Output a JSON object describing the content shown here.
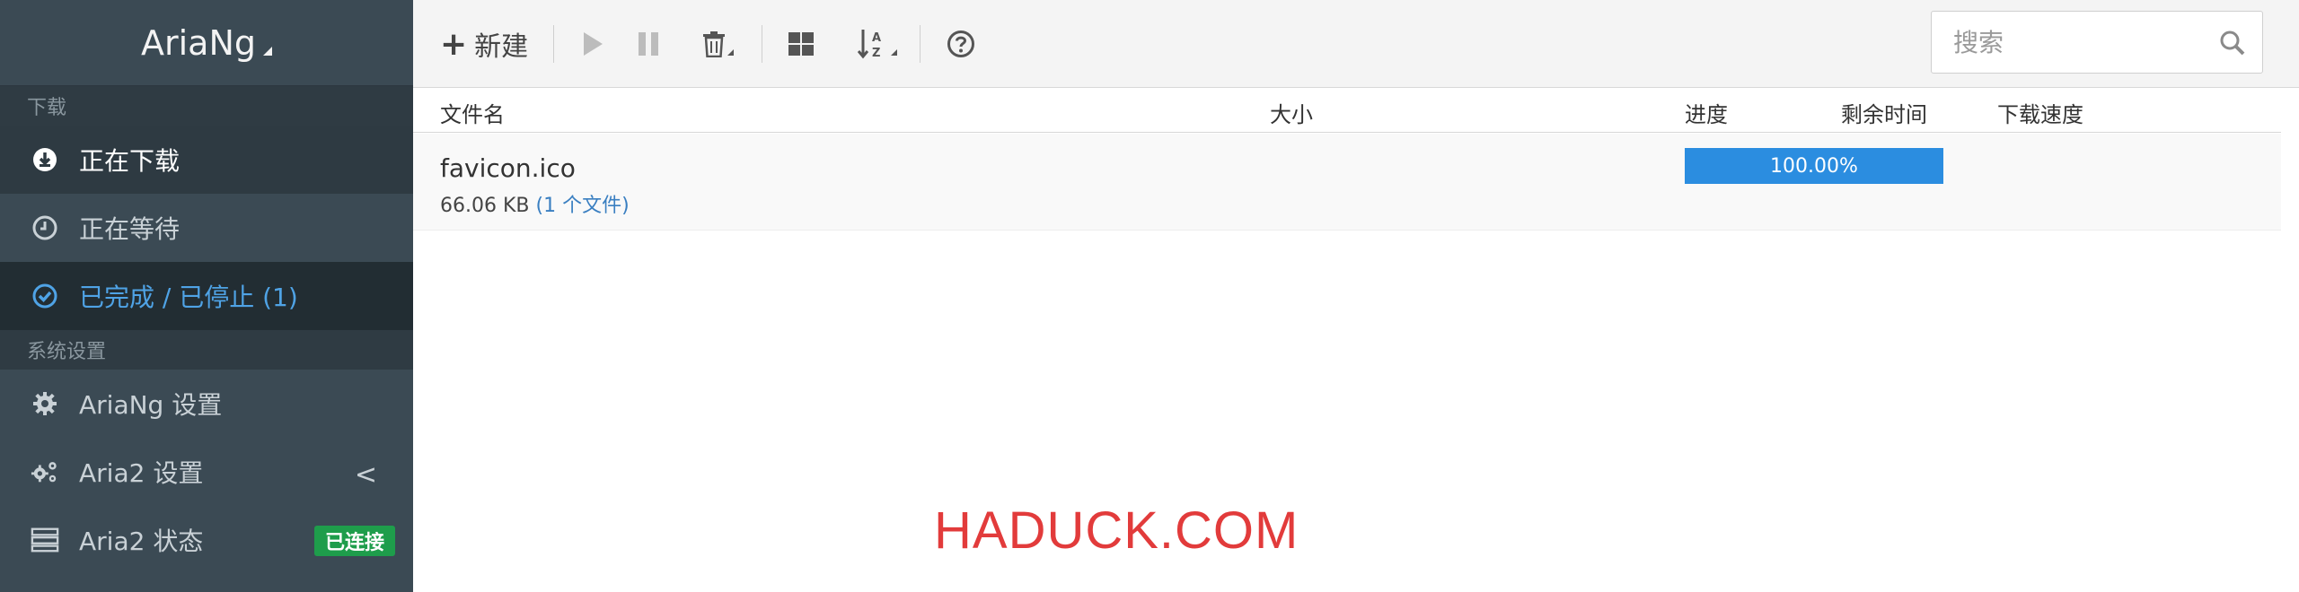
{
  "app": {
    "brand": "AriaNg"
  },
  "sidebar": {
    "sections": [
      {
        "title": "下载"
      },
      {
        "title": "系统设置"
      }
    ],
    "items": [
      {
        "label": "正在下载",
        "icon": "download-circle-icon"
      },
      {
        "label": "正在等待",
        "icon": "clock-icon"
      },
      {
        "label": "已完成 / 已停止 (1)",
        "icon": "check-circle-icon"
      },
      {
        "label": "AriaNg 设置",
        "icon": "gear-icon"
      },
      {
        "label": "Aria2 设置",
        "icon": "gears-icon",
        "chevron": "<"
      },
      {
        "label": "Aria2 状态",
        "icon": "server-icon",
        "badge": "已连接"
      }
    ]
  },
  "toolbar": {
    "new_label": "新建",
    "new_icon": "plus-icon",
    "buttons": [
      "play-icon",
      "pause-icon",
      "trash-icon",
      "grid-icon",
      "sort-az-icon",
      "help-icon"
    ],
    "search_placeholder": "搜索"
  },
  "table": {
    "columns": [
      "文件名",
      "大小",
      "进度",
      "剩余时间",
      "下载速度"
    ],
    "rows": [
      {
        "filename": "favicon.ico",
        "size": "66.06 KB",
        "files": "(1 个文件)",
        "progress_text": "100.00%",
        "progress": 1.0
      }
    ]
  },
  "watermark": "HADUCK.COM",
  "colors": {
    "sidebar_bg": "#3b4a54",
    "active_item": "#4fa3e6",
    "progress": "#2b8de0",
    "badge": "#1e9d4b",
    "watermark": "#e23b3b"
  }
}
